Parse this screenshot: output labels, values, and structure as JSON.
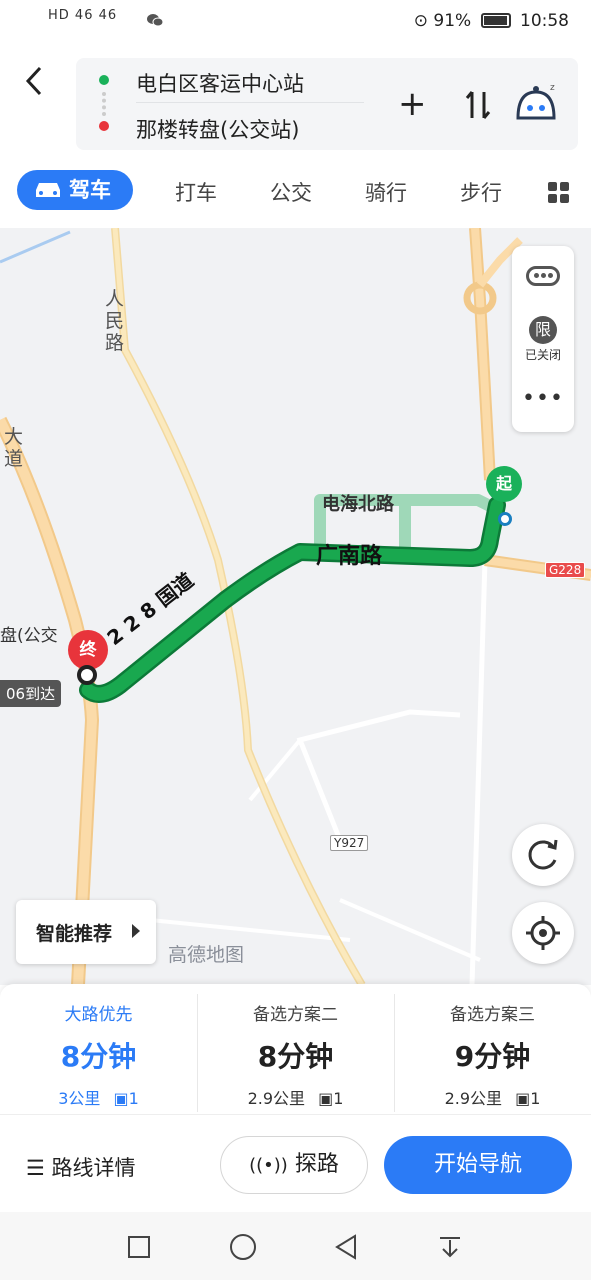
{
  "status": {
    "left": "HD 46 46",
    "battery": "91%",
    "time": "10:58"
  },
  "header": {
    "origin": "电白区客运中心站",
    "destination": "那楼转盘(公交站)"
  },
  "tabs": [
    {
      "label": "驾车",
      "active": true
    },
    {
      "label": "打车"
    },
    {
      "label": "公交"
    },
    {
      "label": "骑行"
    },
    {
      "label": "步行"
    }
  ],
  "map": {
    "roads": {
      "renmin": "人民路",
      "dadao": "大道",
      "dianhai": "电海北路",
      "guangnan": "广南路",
      "guodao": "2 2 8 国道",
      "g228": "G228",
      "y927": "Y927"
    },
    "markers": {
      "start": "起",
      "end": "终"
    },
    "dest_label": "盘(公交",
    "arrive": "06到达",
    "restrict": {
      "icon_text": "限",
      "status": "已关闭"
    },
    "smart": "智能推荐",
    "watermark": "高德地图"
  },
  "routes": [
    {
      "name": "大路优先",
      "time": "8分钟",
      "distance": "3公里",
      "lights": "1",
      "selected": true
    },
    {
      "name": "备选方案二",
      "time": "8分钟",
      "distance": "2.9公里",
      "lights": "1"
    },
    {
      "name": "备选方案三",
      "time": "9分钟",
      "distance": "2.9公里",
      "lights": "1"
    }
  ],
  "actions": {
    "detail": "路线详情",
    "probe": "探路",
    "navigate": "开始导航"
  },
  "colors": {
    "accent": "#2b7bf6",
    "route": "#0fa04a",
    "start": "#1ab15a",
    "end": "#e8343b"
  }
}
